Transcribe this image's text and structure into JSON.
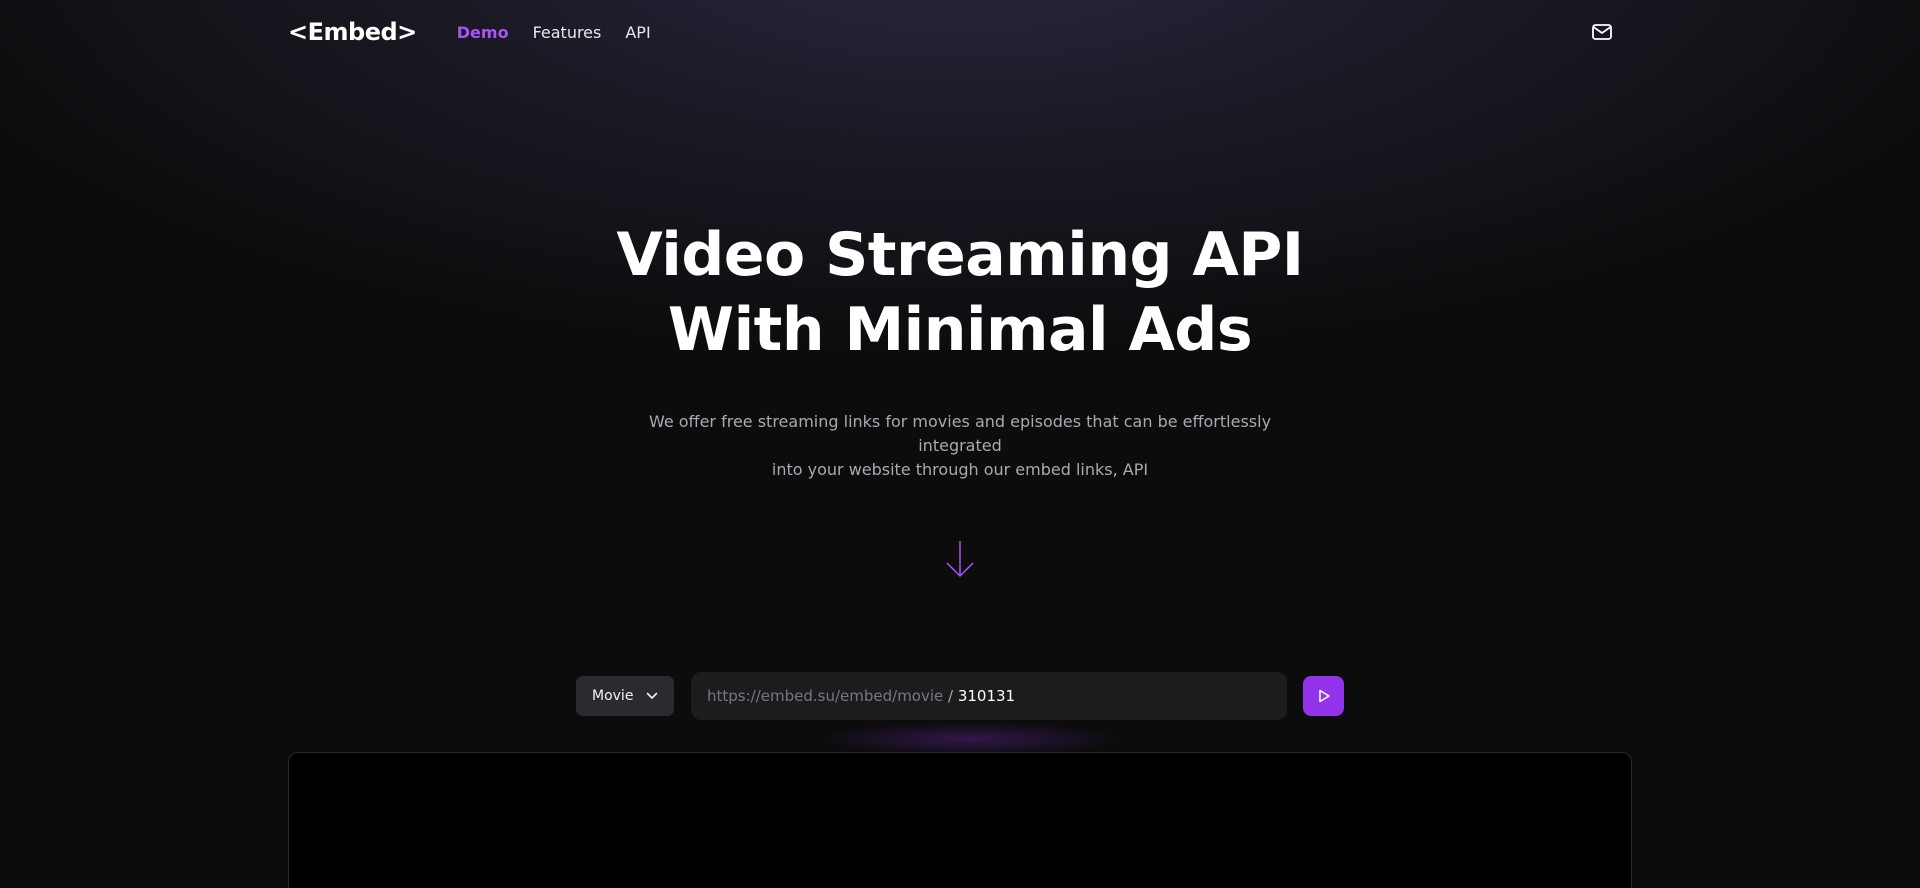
{
  "nav": {
    "logo": "<Embed>",
    "links": [
      {
        "label": "Demo",
        "active": true
      },
      {
        "label": "Features",
        "active": false
      },
      {
        "label": "API",
        "active": false
      }
    ],
    "mail_icon": "mail-icon"
  },
  "hero": {
    "title_line1": "Video Streaming API",
    "title_line2": "With Minimal Ads",
    "subtitle_line1": "We offer free streaming links for movies and episodes that can be effortlessly integrated",
    "subtitle_line2": "into your website through our embed links, API",
    "arrow_icon": "arrow-down-icon"
  },
  "controls": {
    "type_select": {
      "selected": "Movie",
      "icon": "chevron-down-icon"
    },
    "url": {
      "prefix": "https://embed.su/embed/movie",
      "separator": " / ",
      "value": "310131"
    },
    "play_icon": "play-icon"
  },
  "colors": {
    "accent": "#a855f7",
    "button": "#9333ea",
    "background": "#0c0c0d"
  }
}
